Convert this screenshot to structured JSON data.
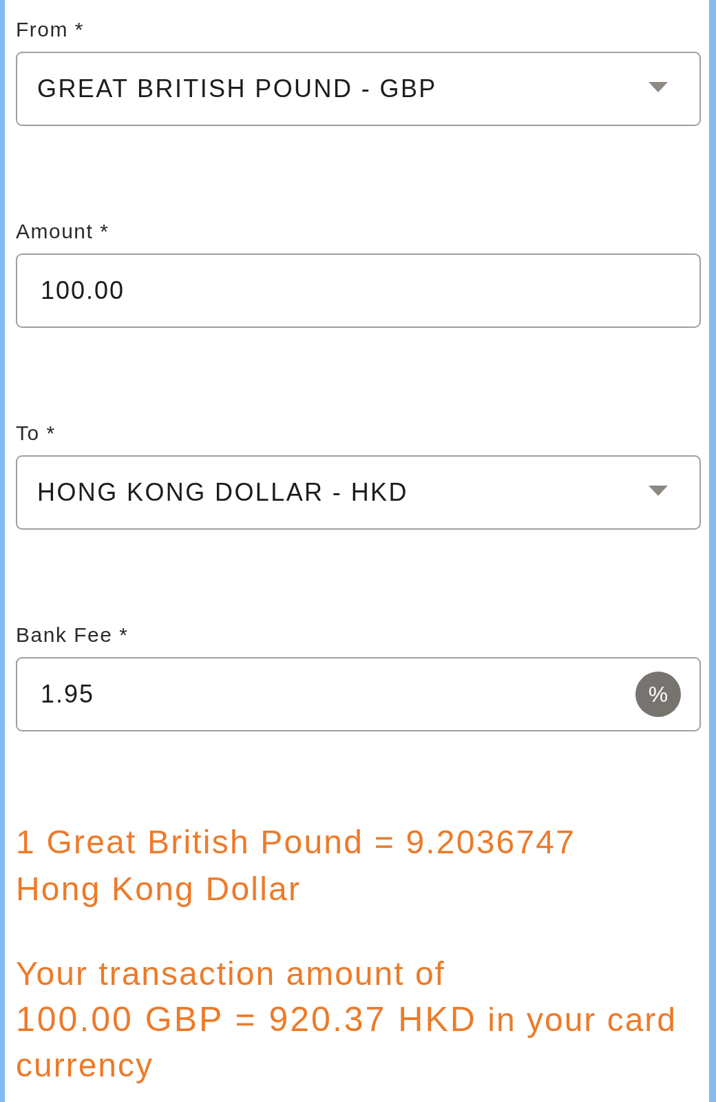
{
  "fields": [
    {
      "kind": "select",
      "label": "From *",
      "value": "GREAT BRITISH POUND - GBP"
    },
    {
      "kind": "input",
      "label": "Amount *",
      "value": "100.00"
    },
    {
      "kind": "select",
      "label": "To *",
      "value": "HONG KONG DOLLAR - HKD"
    },
    {
      "kind": "input",
      "label": "Bank Fee *",
      "value": "1.95",
      "button": "%"
    }
  ],
  "rate_text": {
    "parts": [
      {
        "kind": "plain",
        "text": "1 Great British Pound = 9.2036747"
      },
      {
        "kind": "unit",
        "text": "Hong Kong Dollar"
      }
    ]
  },
  "result_text": {
    "parts": [
      {
        "kind": "plain",
        "text": "Your transaction amount of"
      },
      {
        "kind": "figure",
        "text": "100.00 GBP = 920.37 HKD"
      },
      {
        "kind": "plain",
        "text": "in your card currency"
      }
    ]
  }
}
